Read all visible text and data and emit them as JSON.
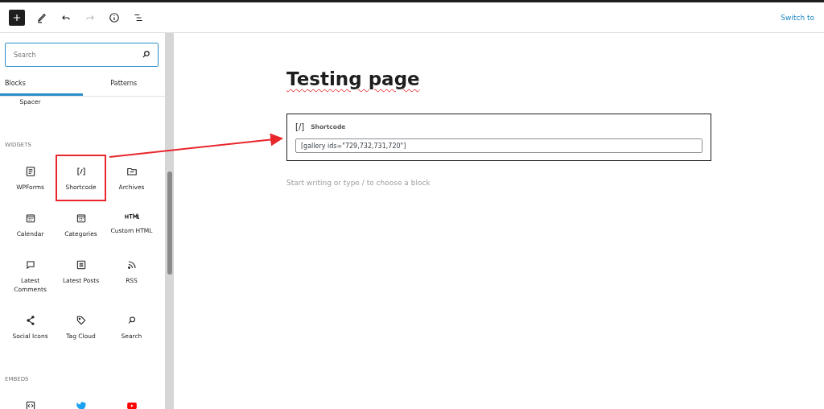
{
  "toolbar": {
    "buttons": [
      {
        "kind": "add",
        "disabled": false
      },
      {
        "kind": "edit",
        "disabled": false
      },
      {
        "kind": "undo",
        "disabled": false
      },
      {
        "kind": "redo",
        "disabled": true
      },
      {
        "kind": "info",
        "disabled": false
      },
      {
        "kind": "outline",
        "disabled": false
      }
    ],
    "link": "Switch to"
  },
  "sidebar": {
    "search": {
      "placeholder": "Search"
    },
    "tabs": [
      {
        "label": "Blocks",
        "selected": true
      },
      {
        "label": "Patterns",
        "selected": false
      }
    ],
    "sections": [
      {
        "items": [
          {
            "kind": "none",
            "label": "Spacer",
            "highlighted": false
          }
        ]
      },
      {
        "title": "WIDGETS",
        "items": [
          {
            "kind": "form",
            "label": "WPForms",
            "highlighted": false
          },
          {
            "kind": "shortcode",
            "label": "Shortcode",
            "highlighted": true
          },
          {
            "kind": "folder",
            "label": "Archives",
            "highlighted": false
          },
          {
            "kind": "calendar",
            "label": "Calendar",
            "highlighted": false
          },
          {
            "kind": "calendar",
            "label": "Categories",
            "highlighted": false
          },
          {
            "kind": "html",
            "label": "Custom HTML",
            "highlighted": false
          },
          {
            "kind": "comment",
            "label": "Latest Comments",
            "highlighted": false
          },
          {
            "kind": "list",
            "label": "Latest Posts",
            "highlighted": false
          },
          {
            "kind": "rss",
            "label": "RSS",
            "highlighted": false
          },
          {
            "kind": "share",
            "label": "Social Icons",
            "highlighted": false
          },
          {
            "kind": "tag",
            "label": "Tag Cloud",
            "highlighted": false
          },
          {
            "kind": "search",
            "label": "Search",
            "highlighted": false
          }
        ]
      },
      {
        "title": "EMBEDS",
        "items": [
          {
            "kind": "embed",
            "highlighted": false
          },
          {
            "kind": "bird",
            "highlighted": false
          },
          {
            "kind": "play",
            "highlighted": false
          }
        ]
      }
    ]
  },
  "editor": {
    "title": "Testing page",
    "block": {
      "glyph": "[/]",
      "label": "Shortcode",
      "value": "[gallery ids=\"729,732,731,720\"]"
    },
    "placeholder": "Start writing or type / to choose a block"
  },
  "annotation": {
    "arrow": true
  }
}
